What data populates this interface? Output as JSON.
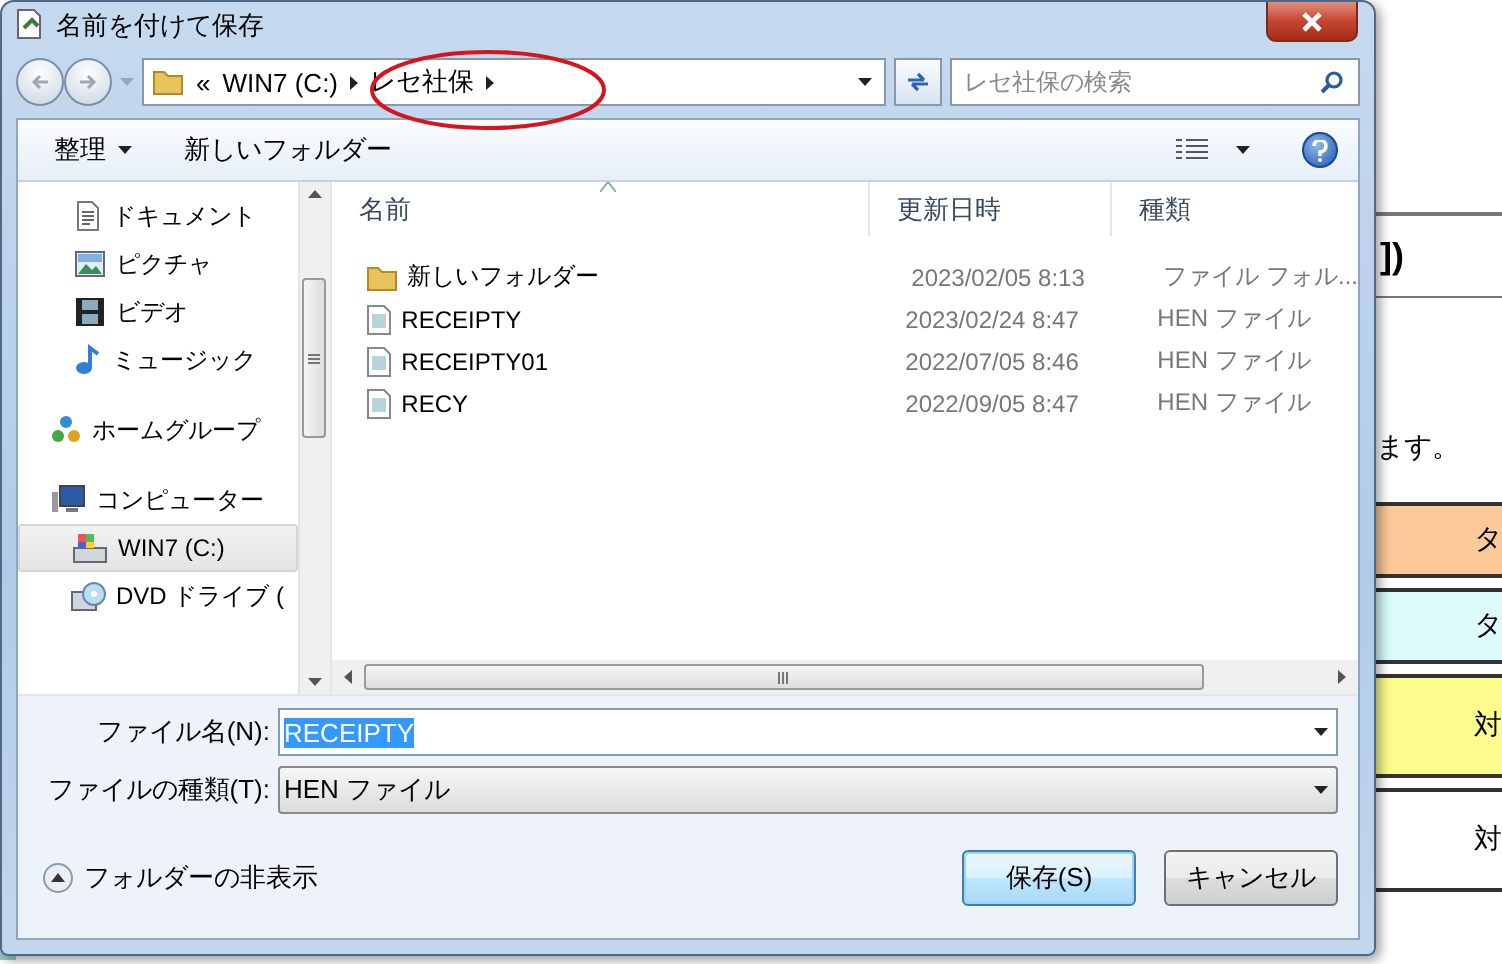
{
  "background": {
    "texts": [
      "])",
      "ます。"
    ],
    "cells": [
      {
        "text": "タ",
        "color": "#fcc998"
      },
      {
        "text": "タ",
        "color": "#dcfcfc"
      },
      {
        "text": "対",
        "color": "#fcfc8c"
      },
      {
        "text": "対",
        "color": "#ffffff"
      }
    ]
  },
  "dialog": {
    "title": "名前を付けて保存",
    "address": {
      "chevron": "«",
      "path": [
        "WIN7 (C:)",
        "レセ社保"
      ]
    },
    "search": {
      "placeholder": "レセ社保の検索"
    },
    "toolbar": {
      "organize": "整理",
      "new_folder": "新しいフォルダー"
    },
    "nav": {
      "libraries": [
        {
          "label": "ドキュメント",
          "kind": "document",
          "selected": false
        },
        {
          "label": "ピクチャ",
          "kind": "picture",
          "selected": false
        },
        {
          "label": "ビデオ",
          "kind": "video",
          "selected": false
        },
        {
          "label": "ミュージック",
          "kind": "music",
          "selected": false
        }
      ],
      "items": [
        {
          "label": "ホームグループ",
          "kind": "homegroup",
          "selected": false
        },
        {
          "label": "コンピューター",
          "kind": "computer",
          "selected": false,
          "children": [
            {
              "label": "WIN7 (C:)",
              "kind": "drive",
              "selected": true
            },
            {
              "label": "DVD ドライブ (",
              "kind": "dvd",
              "selected": false
            }
          ]
        }
      ]
    },
    "columns": [
      {
        "label": "名前",
        "sorted": true
      },
      {
        "label": "更新日時",
        "sorted": false
      },
      {
        "label": "種類",
        "sorted": false
      }
    ],
    "rows": [
      {
        "kind": "folder",
        "name": "新しいフォルダー",
        "date": "2023/02/05 8:13",
        "type": "ファイル フォル..."
      },
      {
        "kind": "file",
        "name": "RECEIPTY",
        "date": "2023/02/24 8:47",
        "type": "HEN ファイル"
      },
      {
        "kind": "file",
        "name": "RECEIPTY01",
        "date": "2022/07/05 8:46",
        "type": "HEN ファイル"
      },
      {
        "kind": "file",
        "name": "RECY",
        "date": "2022/09/05 8:47",
        "type": "HEN ファイル"
      }
    ],
    "filename": {
      "label": "ファイル名(N):",
      "value": "RECEIPTY",
      "value_selected": true
    },
    "filetype": {
      "label": "ファイルの種類(T):",
      "value": "HEN ファイル"
    },
    "hide_folders": "フォルダーの非表示",
    "buttons": [
      {
        "label": "保存(S)",
        "default": true
      },
      {
        "label": "キャンセル",
        "default": false
      }
    ]
  }
}
